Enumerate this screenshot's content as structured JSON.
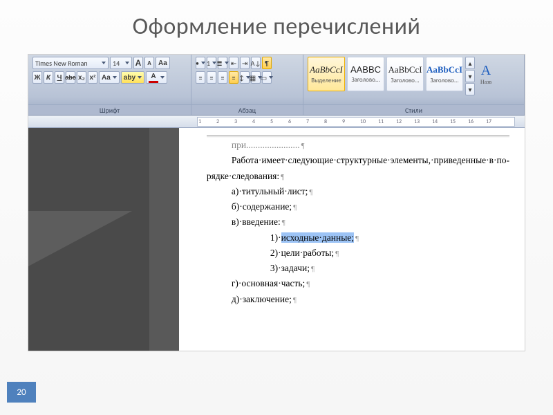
{
  "slide": {
    "title": "Оформление перечислений",
    "page_number": "20"
  },
  "ribbon": {
    "font": {
      "group_label": "Шрифт",
      "name": "Times New Roman",
      "size": "14",
      "bold": "Ж",
      "italic": "К",
      "underline": "Ч",
      "strike": "abc",
      "sub": "x₂",
      "sup": "x²",
      "grow": "A",
      "shrink": "A",
      "clear": "Aa",
      "case": "Aa",
      "fill": "aby",
      "color": "A"
    },
    "para": {
      "group_label": "Абзац",
      "bullets": "•",
      "numbers": "1",
      "multilevel": "≣",
      "dec_indent": "⇤",
      "inc_indent": "⇥",
      "sort": "A↓",
      "marks": "¶",
      "al": "≡",
      "ac": "≡",
      "ar": "≡",
      "aj": "≡",
      "spacing": "↕",
      "shading": "▦",
      "borders": "▭"
    },
    "styles": {
      "group_label": "Стили",
      "tiles": [
        {
          "sample": "AaBbCcI",
          "label": "Выделение"
        },
        {
          "sample": "AABBC",
          "label": "Заголово..."
        },
        {
          "sample": "AaBbCcI",
          "label": "Заголово..."
        },
        {
          "sample": "AaBbCcI",
          "label": "Заголово..."
        }
      ],
      "more": "Изменить стили",
      "partial_next": "Назв"
    }
  },
  "ruler": {
    "ticks": [
      "1",
      "2",
      "3",
      "4",
      "5",
      "6",
      "7",
      "8",
      "9",
      "10",
      "11",
      "12",
      "13",
      "14",
      "15",
      "16",
      "17"
    ]
  },
  "doc": {
    "topline": "при.......................",
    "intro1": "Работа·имеет·следующие·структурные·элементы,·приведенные·в·по-",
    "intro2": "рядке·следования:",
    "a": "а)·титульный·лист;",
    "b": "б)·содержание;",
    "v": "в)·введение:",
    "v1_prefix": "1)·",
    "v1_hl": "исходные·данные;",
    "v2": "2)·цели·работы;",
    "v3": "3)·задачи;",
    "g": "г)·основная·часть;",
    "d": "д)·заключение;",
    "para_mark": "¶"
  }
}
